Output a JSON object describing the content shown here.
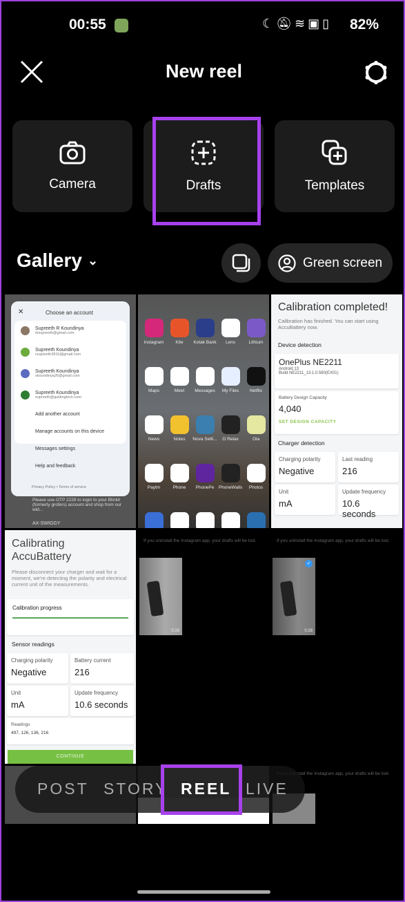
{
  "status": {
    "time": "00:55",
    "battery": "82%"
  },
  "header": {
    "title": "New reel"
  },
  "options": [
    {
      "label": "Camera",
      "icon": "camera-icon"
    },
    {
      "label": "Drafts",
      "icon": "drafts-icon"
    },
    {
      "label": "Templates",
      "icon": "templates-icon"
    }
  ],
  "gallery": {
    "label": "Gallery",
    "green_screen": "Green screen"
  },
  "thumbs": {
    "account": {
      "title": "Choose an account",
      "accounts": [
        {
          "name": "Supreeth R Koundinya",
          "email": "rksupreeth@gmail.com"
        },
        {
          "name": "Supreeth Koundinya",
          "email": "rsupreeth2810@gmail.com"
        },
        {
          "name": "Supreeth Koundinya",
          "email": "skoundinya26@gmail.com"
        },
        {
          "name": "Supreeth Koundinya",
          "email": "supreeth@guidingtech.com"
        }
      ],
      "add": "Add another account",
      "manage": "Manage accounts on this device",
      "settings": "Messages settings",
      "help": "Help and feedback",
      "privacy": "Privacy Policy",
      "terms": "Terms of service",
      "bg_text": "Please use OTP 2228 to login to your Blinkit (formerly grofers) account and shop from our wid...",
      "bg_sender": "AX-SWIGGY"
    },
    "apps": [
      "Instagram",
      "Kite",
      "Kotak Bank",
      "Lens",
      "Lithium",
      "Maps",
      "Meet",
      "Messages",
      "My Files",
      "Netflix",
      "News",
      "Notes",
      "Nova Setti...",
      "O Relax",
      "Ola",
      "Paytm",
      "Phone",
      "PhonePe",
      "PhoneWalls",
      "Photos"
    ],
    "completed": {
      "title": "Calibration completed!",
      "sub": "Calibration has finished. You can start using AccuBattery now.",
      "device_h": "Device detection",
      "device": "OnePlus NE2211",
      "android": "Android 13",
      "build": "Build NE2211_13.1.0.580(EX01)",
      "cap_l": "Battery Design Capacity",
      "cap": "4,040",
      "set": "SET DESIGN CAPACITY",
      "charger_h": "Charger detection",
      "pol_l": "Charging polarity",
      "pol": "Negative",
      "last_l": "Last reading",
      "last": "216",
      "unit_l": "Unit",
      "unit": "mA",
      "freq_l": "Update frequency",
      "freq": "10.6 seconds"
    },
    "calibrating": {
      "title": "Calibrating AccuBattery",
      "sub": "Please disconnect your charger and wait for a moment, we're detecting the polarity and electrical current unit of the measurements.",
      "progress": "Calibration progress",
      "progress_value": 1.0,
      "sensor": "Sensor readings",
      "pol_l": "Charging polarity",
      "pol": "Negative",
      "cur_l": "Battery current",
      "cur": "216",
      "unit_l": "Unit",
      "unit": "mA",
      "freq_l": "Update frequency",
      "freq": "10.6 seconds",
      "read_l": "Readings",
      "read": "497, 126, 136, 216",
      "continue": "CONTINUE"
    },
    "draft_note": "If you uninstall the Instagram app, your drafts will be lost.",
    "duration": "0:28"
  },
  "modes": [
    "POST",
    "STORY",
    "REEL",
    "LIVE"
  ],
  "colors": {
    "highlight": "#a741ec",
    "accent_green": "#76c043"
  }
}
